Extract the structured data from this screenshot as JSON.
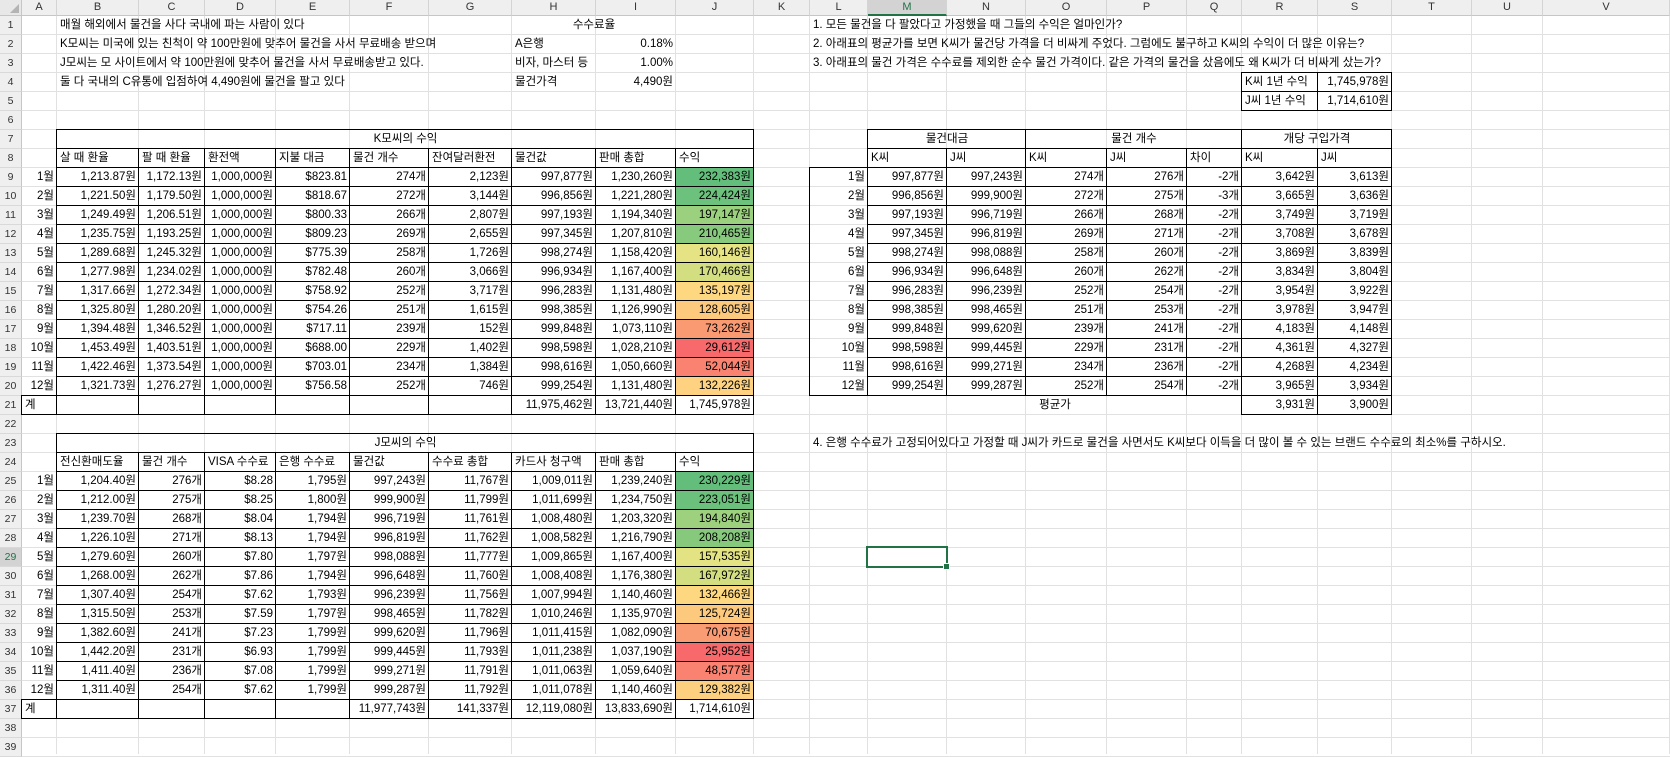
{
  "columns": [
    "A",
    "B",
    "C",
    "D",
    "E",
    "F",
    "G",
    "H",
    "I",
    "J",
    "K",
    "L",
    "M",
    "N",
    "O",
    "P",
    "Q",
    "R",
    "S",
    "T",
    "U",
    "V"
  ],
  "selected_cell": "M29",
  "intro": {
    "lines": [
      "매월 해외에서 물건을 사다 국내에 파는 사람이 있다",
      "K모씨는 미국에 있는 친척이 약 100만원에 맞추어 물건을 사서 무료배송 받으며",
      "J모씨는 모 사이트에서 약 100만원에 맞추어 물건을 사서 무료배송받고 있다.",
      "둘 다 국내의 C유통에 입점하여 4,490원에 물건을 팔고 있다"
    ],
    "fee_title": "수수료율",
    "fees": [
      {
        "label": "A은행",
        "value": "0.18%"
      },
      {
        "label": "비자, 마스터 등",
        "value": "1.00%"
      },
      {
        "label": "물건가격",
        "value": "4,490원"
      }
    ]
  },
  "questions": [
    "1. 모든 물건을 다 팔았다고 가정했을 때 그들의 수익은 얼마인가?",
    "2. 아래표의 평균가를 보면 K씨가 물건당 가격을 더 비싸게 주었다. 그럼에도 불구하고 K씨의 수익이 더 많은 이유는?",
    "3. 아래표의 물건 가격은 수수료를 제외한 순수 물건 가격이다. 같은 가격의  물건을 샀음에도 왜 K씨가 더 비싸게 샀는가?"
  ],
  "question4": "4. 은행 수수료가 고정되어있다고 가정할 때 J씨가 카드로 물건을 사면서도 K씨보다 이득을 더 많이 볼 수 있는 브랜드 수수료의 최소%를 구하시오.",
  "annual": [
    {
      "label": "K씨 1년 수익",
      "value": "1,745,978원"
    },
    {
      "label": "J씨 1년 수익",
      "value": "1,714,610원"
    }
  ],
  "k_table": {
    "title": "K모씨의 수익",
    "headers": [
      "살 때 환율",
      "팔 때 환율",
      "환전액",
      "지불 대금",
      "물건 개수",
      "잔여달러환전",
      "물건값",
      "판매 총합",
      "수익"
    ],
    "rows": [
      {
        "m": "1월",
        "v": [
          "1,213.87원",
          "1,172.13원",
          "1,000,000원",
          "$823.81",
          "274개",
          "2,123원",
          "997,877원",
          "1,230,260원",
          "232,383원"
        ],
        "c": "#63be7b"
      },
      {
        "m": "2월",
        "v": [
          "1,221.50원",
          "1,179.50원",
          "1,000,000원",
          "$818.67",
          "272개",
          "3,144원",
          "996,856원",
          "1,221,280원",
          "224,424원"
        ],
        "c": "#6cc17c"
      },
      {
        "m": "3월",
        "v": [
          "1,249.49원",
          "1,206.51원",
          "1,000,000원",
          "$800.33",
          "266개",
          "2,807원",
          "997,193원",
          "1,194,340원",
          "197,147원"
        ],
        "c": "#9bd07e"
      },
      {
        "m": "4월",
        "v": [
          "1,235.75원",
          "1,193.25원",
          "1,000,000원",
          "$809.23",
          "269개",
          "2,655원",
          "997,345원",
          "1,207,810원",
          "210,465원"
        ],
        "c": "#87c97d"
      },
      {
        "m": "5월",
        "v": [
          "1,289.68원",
          "1,245.32원",
          "1,000,000원",
          "$775.39",
          "258개",
          "1,726원",
          "998,274원",
          "1,158,420원",
          "160,146원"
        ],
        "c": "#e5e383"
      },
      {
        "m": "6월",
        "v": [
          "1,277.98원",
          "1,234.02원",
          "1,000,000원",
          "$782.48",
          "260개",
          "3,066원",
          "996,934원",
          "1,167,400원",
          "170,466원"
        ],
        "c": "#d3de81"
      },
      {
        "m": "7월",
        "v": [
          "1,317.66원",
          "1,272.34원",
          "1,000,000원",
          "$758.92",
          "252개",
          "3,717원",
          "996,283원",
          "1,131,480원",
          "135,197원"
        ],
        "c": "#fed880"
      },
      {
        "m": "8월",
        "v": [
          "1,325.80원",
          "1,280.20원",
          "1,000,000원",
          "$754.26",
          "251개",
          "1,615원",
          "998,385원",
          "1,126,990원",
          "128,605원"
        ],
        "c": "#fdc97d"
      },
      {
        "m": "9월",
        "v": [
          "1,394.48원",
          "1,346.52원",
          "1,000,000원",
          "$717.11",
          "239개",
          "152원",
          "999,848원",
          "1,073,110원",
          "73,262원"
        ],
        "c": "#f99a73"
      },
      {
        "m": "10월",
        "v": [
          "1,453.49원",
          "1,403.51원",
          "1,000,000원",
          "$688.00",
          "229개",
          "1,402원",
          "998,598원",
          "1,028,210원",
          "29,612원"
        ],
        "c": "#f8696b"
      },
      {
        "m": "11월",
        "v": [
          "1,422.46원",
          "1,373.54원",
          "1,000,000원",
          "$703.01",
          "234개",
          "1,384원",
          "998,616원",
          "1,050,660원",
          "52,044원"
        ],
        "c": "#f98370"
      },
      {
        "m": "12월",
        "v": [
          "1,321.73원",
          "1,276.27원",
          "1,000,000원",
          "$756.58",
          "252개",
          "746원",
          "999,254원",
          "1,131,480원",
          "132,226원"
        ],
        "c": "#fed280"
      }
    ],
    "total_label": "계",
    "totals": [
      "11,975,462원",
      "13,721,440원",
      "1,745,978원"
    ]
  },
  "j_table": {
    "title": "J모씨의 수익",
    "headers": [
      "전신환매도율",
      "물건 개수",
      "VISA 수수료",
      "은행 수수료",
      "물건값",
      "수수료 총합",
      "카드사 청구액",
      "판매 총합",
      "수익"
    ],
    "rows": [
      {
        "m": "1월",
        "v": [
          "1,204.40원",
          "276개",
          "$8.28",
          "1,795원",
          "997,243원",
          "11,767원",
          "1,009,011원",
          "1,239,240원",
          "230,229원"
        ],
        "c": "#63be7b"
      },
      {
        "m": "2월",
        "v": [
          "1,212.00원",
          "275개",
          "$8.25",
          "1,800원",
          "999,900원",
          "11,799원",
          "1,011,699원",
          "1,234,750원",
          "223,051원"
        ],
        "c": "#6bc07c"
      },
      {
        "m": "3월",
        "v": [
          "1,239.70원",
          "268개",
          "$8.04",
          "1,794원",
          "996,719원",
          "11,761원",
          "1,008,480원",
          "1,203,320원",
          "194,840원"
        ],
        "c": "#9dd17e"
      },
      {
        "m": "4월",
        "v": [
          "1,226.10원",
          "271개",
          "$8.13",
          "1,794원",
          "996,819원",
          "11,762원",
          "1,008,582원",
          "1,216,790원",
          "208,208원"
        ],
        "c": "#86c97d"
      },
      {
        "m": "5월",
        "v": [
          "1,279.60원",
          "260개",
          "$7.80",
          "1,797원",
          "998,088원",
          "11,777원",
          "1,009,865원",
          "1,167,400원",
          "157,535원"
        ],
        "c": "#e4e383"
      },
      {
        "m": "6월",
        "v": [
          "1,268.00원",
          "262개",
          "$7.86",
          "1,794원",
          "996,648원",
          "11,760원",
          "1,008,408원",
          "1,176,380원",
          "167,972원"
        ],
        "c": "#d3de81"
      },
      {
        "m": "7월",
        "v": [
          "1,307.40원",
          "254개",
          "$7.62",
          "1,793원",
          "996,239원",
          "11,756원",
          "1,007,994원",
          "1,140,460원",
          "132,466원"
        ],
        "c": "#fed880"
      },
      {
        "m": "8월",
        "v": [
          "1,315.50원",
          "253개",
          "$7.59",
          "1,797원",
          "998,465원",
          "11,782원",
          "1,010,246원",
          "1,135,970원",
          "125,724원"
        ],
        "c": "#fdca7d"
      },
      {
        "m": "9월",
        "v": [
          "1,382.60원",
          "241개",
          "$7.23",
          "1,799원",
          "999,620원",
          "11,796원",
          "1,011,415원",
          "1,082,090원",
          "70,675원"
        ],
        "c": "#f99b73"
      },
      {
        "m": "10월",
        "v": [
          "1,442.20원",
          "231개",
          "$6.93",
          "1,799원",
          "999,445원",
          "11,793원",
          "1,011,238원",
          "1,037,190원",
          "25,952원"
        ],
        "c": "#f8696b"
      },
      {
        "m": "11월",
        "v": [
          "1,411.40원",
          "236개",
          "$7.08",
          "1,799원",
          "999,271원",
          "11,791원",
          "1,011,063원",
          "1,059,640원",
          "48,577원"
        ],
        "c": "#f98270"
      },
      {
        "m": "12월",
        "v": [
          "1,311.40원",
          "254개",
          "$7.62",
          "1,799원",
          "999,287원",
          "11,792원",
          "1,011,078원",
          "1,140,460원",
          "129,382원"
        ],
        "c": "#fdd07f"
      }
    ],
    "total_label": "계",
    "totals": [
      "11,977,743원",
      "141,337원",
      "12,119,080원",
      "13,833,690원",
      "1,714,610원"
    ]
  },
  "cmp_table": {
    "groups": [
      "물건대금",
      "물건 개수",
      "개당 구입가격"
    ],
    "sub": [
      "K씨",
      "J씨",
      "K씨",
      "J씨",
      "차이",
      "K씨",
      "J씨"
    ],
    "rows": [
      {
        "m": "1월",
        "v": [
          "997,877원",
          "997,243원",
          "274개",
          "276개",
          "-2개",
          "3,642원",
          "3,613원"
        ]
      },
      {
        "m": "2월",
        "v": [
          "996,856원",
          "999,900원",
          "272개",
          "275개",
          "-3개",
          "3,665원",
          "3,636원"
        ]
      },
      {
        "m": "3월",
        "v": [
          "997,193원",
          "996,719원",
          "266개",
          "268개",
          "-2개",
          "3,749원",
          "3,719원"
        ]
      },
      {
        "m": "4월",
        "v": [
          "997,345원",
          "996,819원",
          "269개",
          "271개",
          "-2개",
          "3,708원",
          "3,678원"
        ]
      },
      {
        "m": "5월",
        "v": [
          "998,274원",
          "998,088원",
          "258개",
          "260개",
          "-2개",
          "3,869원",
          "3,839원"
        ]
      },
      {
        "m": "6월",
        "v": [
          "996,934원",
          "996,648원",
          "260개",
          "262개",
          "-2개",
          "3,834원",
          "3,804원"
        ]
      },
      {
        "m": "7월",
        "v": [
          "996,283원",
          "996,239원",
          "252개",
          "254개",
          "-2개",
          "3,954원",
          "3,922원"
        ]
      },
      {
        "m": "8월",
        "v": [
          "998,385원",
          "998,465원",
          "251개",
          "253개",
          "-2개",
          "3,978원",
          "3,947원"
        ]
      },
      {
        "m": "9월",
        "v": [
          "999,848원",
          "999,620원",
          "239개",
          "241개",
          "-2개",
          "4,183원",
          "4,148원"
        ]
      },
      {
        "m": "10월",
        "v": [
          "998,598원",
          "999,445원",
          "229개",
          "231개",
          "-2개",
          "4,361원",
          "4,327원"
        ]
      },
      {
        "m": "11월",
        "v": [
          "998,616원",
          "999,271원",
          "234개",
          "236개",
          "-2개",
          "4,268원",
          "4,234원"
        ]
      },
      {
        "m": "12월",
        "v": [
          "999,254원",
          "999,287원",
          "252개",
          "254개",
          "-2개",
          "3,965원",
          "3,934원"
        ]
      }
    ],
    "avg_label": "평균가",
    "avg": [
      "3,931원",
      "3,900원"
    ]
  }
}
